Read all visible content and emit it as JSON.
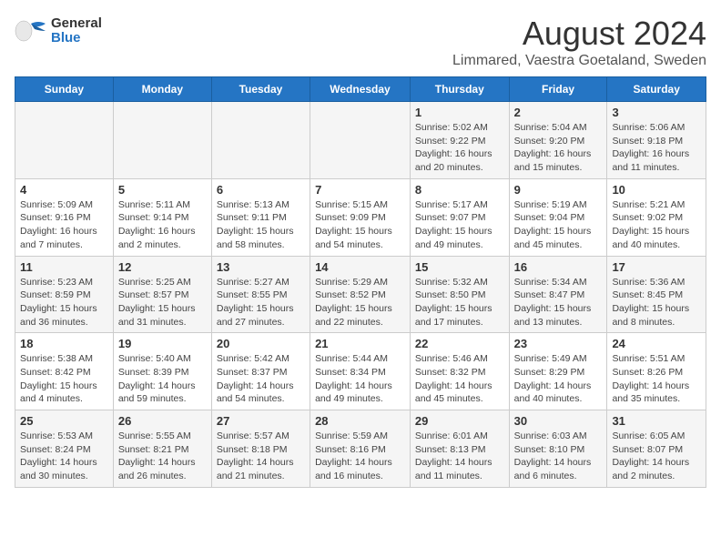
{
  "header": {
    "logo_line1": "General",
    "logo_line2": "Blue",
    "title": "August 2024",
    "subtitle": "Limmared, Vaestra Goetaland, Sweden"
  },
  "days_of_week": [
    "Sunday",
    "Monday",
    "Tuesday",
    "Wednesday",
    "Thursday",
    "Friday",
    "Saturday"
  ],
  "weeks": [
    [
      {
        "day": "",
        "info": ""
      },
      {
        "day": "",
        "info": ""
      },
      {
        "day": "",
        "info": ""
      },
      {
        "day": "",
        "info": ""
      },
      {
        "day": "1",
        "info": "Sunrise: 5:02 AM\nSunset: 9:22 PM\nDaylight: 16 hours and 20 minutes."
      },
      {
        "day": "2",
        "info": "Sunrise: 5:04 AM\nSunset: 9:20 PM\nDaylight: 16 hours and 15 minutes."
      },
      {
        "day": "3",
        "info": "Sunrise: 5:06 AM\nSunset: 9:18 PM\nDaylight: 16 hours and 11 minutes."
      }
    ],
    [
      {
        "day": "4",
        "info": "Sunrise: 5:09 AM\nSunset: 9:16 PM\nDaylight: 16 hours and 7 minutes."
      },
      {
        "day": "5",
        "info": "Sunrise: 5:11 AM\nSunset: 9:14 PM\nDaylight: 16 hours and 2 minutes."
      },
      {
        "day": "6",
        "info": "Sunrise: 5:13 AM\nSunset: 9:11 PM\nDaylight: 15 hours and 58 minutes."
      },
      {
        "day": "7",
        "info": "Sunrise: 5:15 AM\nSunset: 9:09 PM\nDaylight: 15 hours and 54 minutes."
      },
      {
        "day": "8",
        "info": "Sunrise: 5:17 AM\nSunset: 9:07 PM\nDaylight: 15 hours and 49 minutes."
      },
      {
        "day": "9",
        "info": "Sunrise: 5:19 AM\nSunset: 9:04 PM\nDaylight: 15 hours and 45 minutes."
      },
      {
        "day": "10",
        "info": "Sunrise: 5:21 AM\nSunset: 9:02 PM\nDaylight: 15 hours and 40 minutes."
      }
    ],
    [
      {
        "day": "11",
        "info": "Sunrise: 5:23 AM\nSunset: 8:59 PM\nDaylight: 15 hours and 36 minutes."
      },
      {
        "day": "12",
        "info": "Sunrise: 5:25 AM\nSunset: 8:57 PM\nDaylight: 15 hours and 31 minutes."
      },
      {
        "day": "13",
        "info": "Sunrise: 5:27 AM\nSunset: 8:55 PM\nDaylight: 15 hours and 27 minutes."
      },
      {
        "day": "14",
        "info": "Sunrise: 5:29 AM\nSunset: 8:52 PM\nDaylight: 15 hours and 22 minutes."
      },
      {
        "day": "15",
        "info": "Sunrise: 5:32 AM\nSunset: 8:50 PM\nDaylight: 15 hours and 17 minutes."
      },
      {
        "day": "16",
        "info": "Sunrise: 5:34 AM\nSunset: 8:47 PM\nDaylight: 15 hours and 13 minutes."
      },
      {
        "day": "17",
        "info": "Sunrise: 5:36 AM\nSunset: 8:45 PM\nDaylight: 15 hours and 8 minutes."
      }
    ],
    [
      {
        "day": "18",
        "info": "Sunrise: 5:38 AM\nSunset: 8:42 PM\nDaylight: 15 hours and 4 minutes."
      },
      {
        "day": "19",
        "info": "Sunrise: 5:40 AM\nSunset: 8:39 PM\nDaylight: 14 hours and 59 minutes."
      },
      {
        "day": "20",
        "info": "Sunrise: 5:42 AM\nSunset: 8:37 PM\nDaylight: 14 hours and 54 minutes."
      },
      {
        "day": "21",
        "info": "Sunrise: 5:44 AM\nSunset: 8:34 PM\nDaylight: 14 hours and 49 minutes."
      },
      {
        "day": "22",
        "info": "Sunrise: 5:46 AM\nSunset: 8:32 PM\nDaylight: 14 hours and 45 minutes."
      },
      {
        "day": "23",
        "info": "Sunrise: 5:49 AM\nSunset: 8:29 PM\nDaylight: 14 hours and 40 minutes."
      },
      {
        "day": "24",
        "info": "Sunrise: 5:51 AM\nSunset: 8:26 PM\nDaylight: 14 hours and 35 minutes."
      }
    ],
    [
      {
        "day": "25",
        "info": "Sunrise: 5:53 AM\nSunset: 8:24 PM\nDaylight: 14 hours and 30 minutes."
      },
      {
        "day": "26",
        "info": "Sunrise: 5:55 AM\nSunset: 8:21 PM\nDaylight: 14 hours and 26 minutes."
      },
      {
        "day": "27",
        "info": "Sunrise: 5:57 AM\nSunset: 8:18 PM\nDaylight: 14 hours and 21 minutes."
      },
      {
        "day": "28",
        "info": "Sunrise: 5:59 AM\nSunset: 8:16 PM\nDaylight: 14 hours and 16 minutes."
      },
      {
        "day": "29",
        "info": "Sunrise: 6:01 AM\nSunset: 8:13 PM\nDaylight: 14 hours and 11 minutes."
      },
      {
        "day": "30",
        "info": "Sunrise: 6:03 AM\nSunset: 8:10 PM\nDaylight: 14 hours and 6 minutes."
      },
      {
        "day": "31",
        "info": "Sunrise: 6:05 AM\nSunset: 8:07 PM\nDaylight: 14 hours and 2 minutes."
      }
    ]
  ]
}
